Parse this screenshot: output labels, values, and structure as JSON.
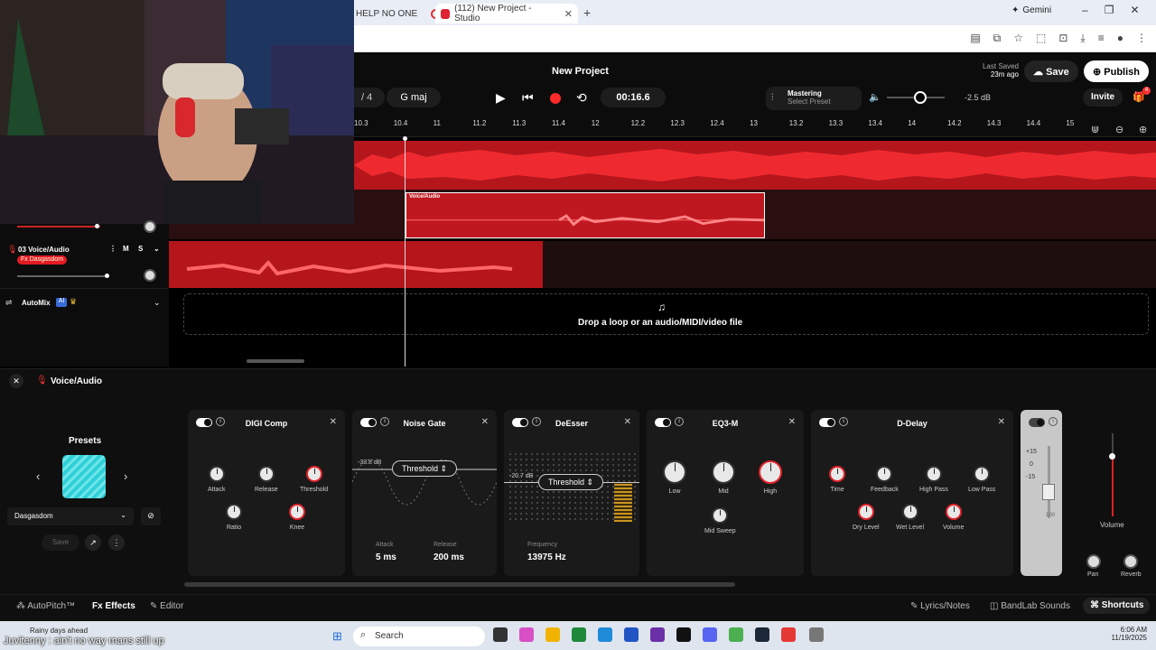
{
  "browser": {
    "tabs": [
      {
        "title": "HELP NO ONE"
      },
      {
        "title": "(112) New Project - Studio"
      }
    ],
    "gemini_label": "Gemini"
  },
  "header": {
    "project_title": "New Project",
    "time_signature": "/ 4",
    "key": "G maj",
    "time": "00:16.6",
    "mastering_title": "Mastering",
    "mastering_preset": "Select Preset",
    "volume_db": "-2.5 dB",
    "last_saved_label": "Last Saved",
    "last_saved_time": "23m ago",
    "save_label": "Save",
    "publish_label": "Publish",
    "invite_label": "Invite",
    "gift_badge": "4"
  },
  "ruler": {
    "ticks": [
      "10.3",
      "10.4",
      "11",
      "11.2",
      "11.3",
      "11.4",
      "12",
      "12.2",
      "12.3",
      "12.4",
      "13",
      "13.2",
      "13.3",
      "13.4",
      "14",
      "14.2",
      "14.3",
      "14.4",
      "15"
    ]
  },
  "tracks": {
    "voice_clip_label": "Voice/Audio",
    "track3_name": "03  Voice/Audio",
    "track3_fx": "Fx Dasgasdom",
    "mute": "M",
    "solo": "S",
    "automix_label": "AutoMix",
    "ai_badge": "AI",
    "drop_text": "Drop a loop or an audio/MIDI/video file"
  },
  "panel": {
    "title": "Voice/Audio",
    "presets_title": "Presets",
    "preset_name": "Dasgasdom",
    "save_label": "Save",
    "effects": [
      {
        "title": "DIGI Comp",
        "knobs": [
          "Attack",
          "Release",
          "Threshold",
          "Ratio",
          "Knee"
        ]
      },
      {
        "title": "Noise Gate",
        "threshold_label": "Threshold",
        "db": "-33.8 dB",
        "attack_label": "Attack",
        "attack_value": "5 ms",
        "release_label": "Release",
        "release_value": "200 ms"
      },
      {
        "title": "DeEsser",
        "threshold_label": "Threshold",
        "db": "-20.7 dB",
        "frequency_label": "Frequency",
        "frequency_value": "13975 Hz"
      },
      {
        "title": "EQ3-M",
        "knobs": [
          "Low",
          "Mid",
          "High",
          "Mid Sweep"
        ]
      },
      {
        "title": "D-Delay",
        "knobs": [
          "Time",
          "Feedback",
          "High Pass",
          "Low Pass",
          "Dry Level",
          "Wet Level",
          "Volume"
        ]
      }
    ],
    "meter_scale": [
      "+15",
      "0",
      "-15",
      "100"
    ],
    "volume_label": "Volume",
    "pan_label": "Pan",
    "reverb_label": "Reverb"
  },
  "bottom_bar": {
    "autopitch": "AutoPitch™",
    "effects": "Effects",
    "editor": "Editor",
    "lyrics": "Lyrics/Notes",
    "sounds": "BandLab Sounds",
    "shortcuts": "Shortcuts"
  },
  "taskbar": {
    "weather": "Rainy days ahead",
    "chat_message": "Juvitenny : ain't no way mans still up",
    "search_placeholder": "Search",
    "time": "6:06 AM",
    "date": "11/19/2025"
  }
}
